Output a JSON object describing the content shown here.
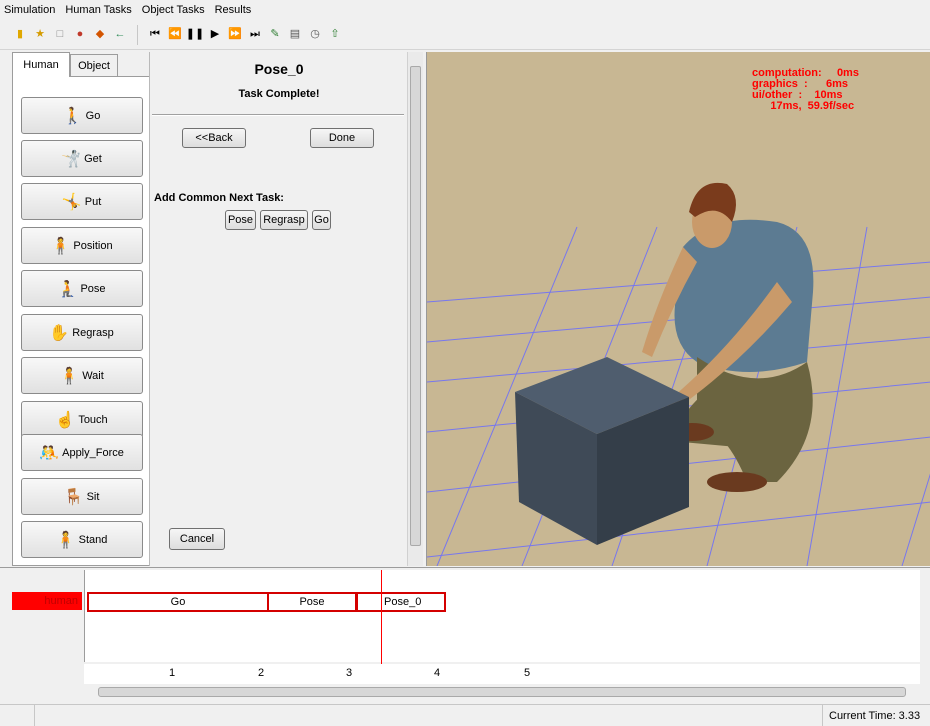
{
  "menu": [
    "Simulation",
    "Human Tasks",
    "Object Tasks",
    "Results"
  ],
  "toolbar": {
    "file_icons": [
      "open-folder-icon",
      "open-icon",
      "new-file-icon",
      "save-icon",
      "import-icon",
      "undo-arrow-icon"
    ],
    "playback_icons": [
      "skip-to-start-icon",
      "rewind-icon",
      "pause-icon",
      "play-icon",
      "fast-forward-icon",
      "skip-to-end-icon",
      "edit-icon",
      "report-icon",
      "clock-icon",
      "export-icon"
    ]
  },
  "left_tabs": {
    "human": "Human",
    "object": "Object"
  },
  "human_tasks": [
    {
      "label": "Go",
      "icon": "walk-icon"
    },
    {
      "label": "Get",
      "icon": "get-icon"
    },
    {
      "label": "Put",
      "icon": "put-icon"
    },
    {
      "label": "Position",
      "icon": "position-icon"
    },
    {
      "label": "Pose",
      "icon": "pose-icon"
    },
    {
      "label": "Regrasp",
      "icon": "regrasp-icon"
    },
    {
      "label": "Wait",
      "icon": "wait-icon"
    },
    {
      "label": "Touch",
      "icon": "touch-icon"
    },
    {
      "label": "Apply_Force",
      "icon": "apply-force-icon"
    },
    {
      "label": "Sit",
      "icon": "sit-icon"
    },
    {
      "label": "Stand",
      "icon": "stand-icon"
    }
  ],
  "task_panel": {
    "title": "Pose_0",
    "status": "Task Complete!",
    "back_label": "<<Back",
    "done_label": "Done",
    "next_task_label": "Add Common Next Task:",
    "next_tasks": [
      "Pose",
      "Regrasp",
      "Go"
    ],
    "cancel_label": "Cancel"
  },
  "viewport": {
    "stats": "computation:     0ms\ngraphics  :      6ms\nui/other  :    10ms\n      17ms,  59.9f/sec",
    "stats_color": "#ff0000",
    "background_color": "#c8b793",
    "grid_color": "#7777ee"
  },
  "timeline": {
    "actor": "human",
    "blocks": [
      "Go",
      "Pose",
      "Pose_0"
    ],
    "ticks": [
      "1",
      "2",
      "3",
      "4",
      "5"
    ]
  },
  "status": {
    "current_time": "Current Time: 3.33"
  }
}
